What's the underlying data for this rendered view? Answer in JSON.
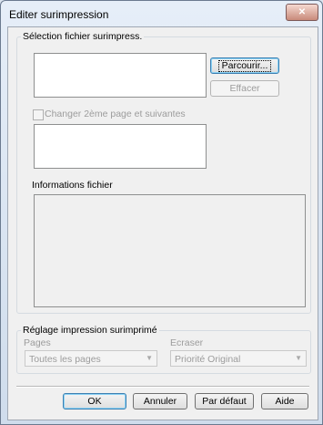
{
  "window": {
    "title": "Editer surimpression",
    "close_glyph": "✕"
  },
  "selection_group": {
    "legend": "Sélection fichier surimpress.",
    "browse_label": "Parcourir...",
    "clear_label": "Effacer",
    "checkbox_label": "Changer 2ème page et suivantes",
    "checkbox_checked": false,
    "info_label": "Informations fichier"
  },
  "print_settings": {
    "legend": "Réglage impression surimprimé",
    "pages_label": "Pages",
    "pages_value": "Toutes les pages",
    "overwrite_label": "Ecraser",
    "overwrite_value": "Priorité Original"
  },
  "footer": {
    "ok_label": "OK",
    "cancel_label": "Annuler",
    "default_label": "Par défaut",
    "help_label": "Aide"
  },
  "colors": {
    "default_button_border": "#3c7fb1",
    "close_button": "#c88a7a"
  }
}
